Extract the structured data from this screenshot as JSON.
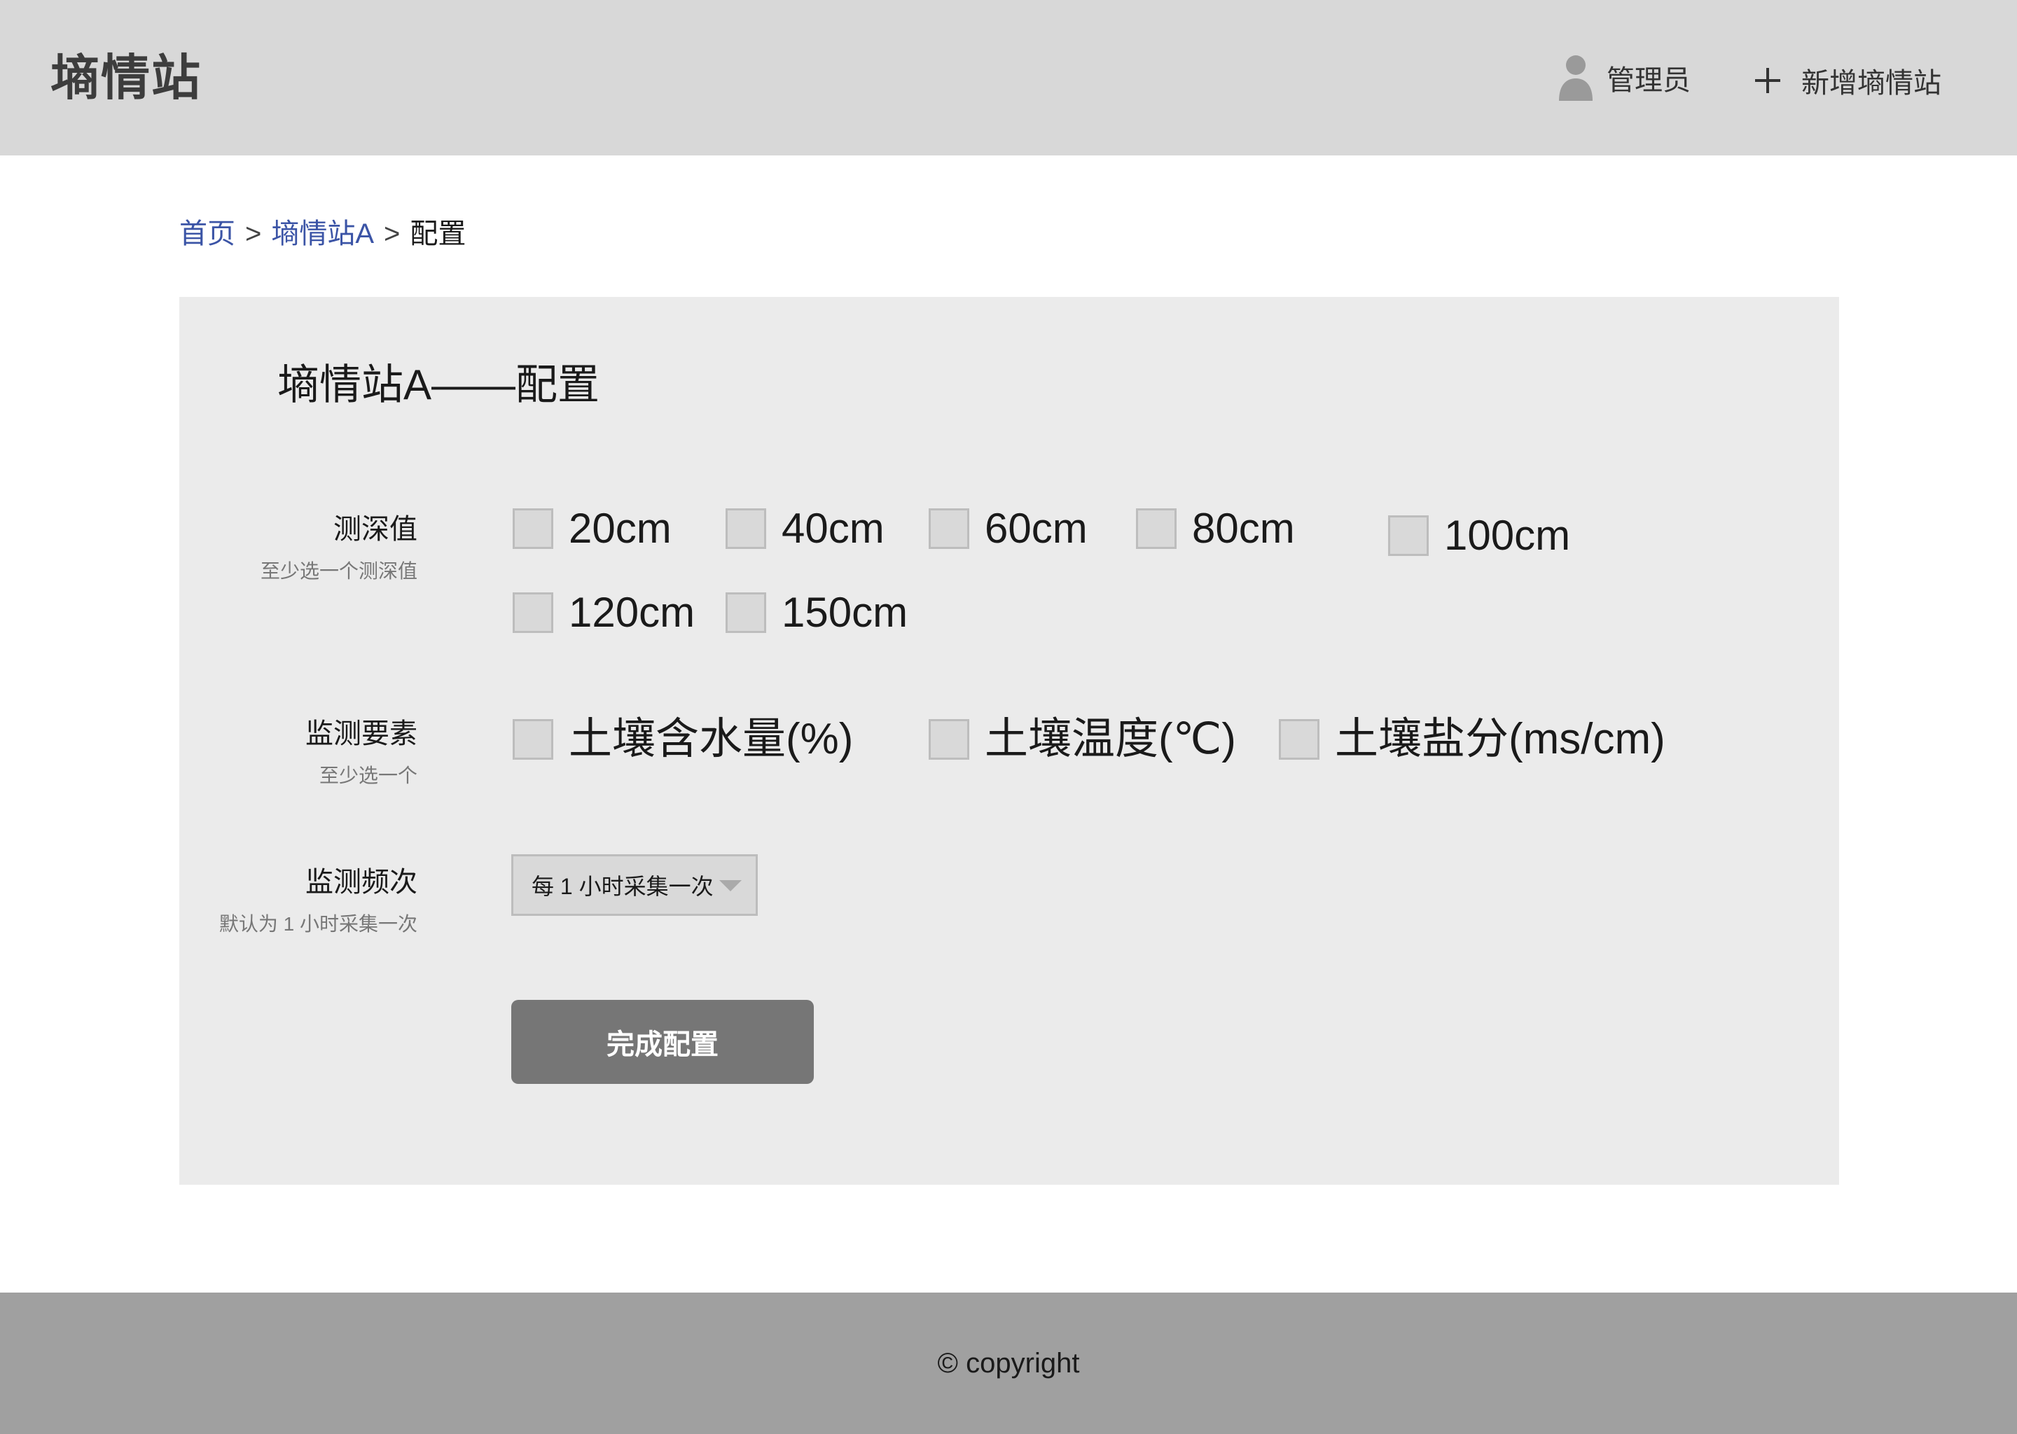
{
  "header": {
    "brand": "墒情站",
    "user_icon": "user-icon",
    "user_label": "管理员",
    "add_icon": "plus-icon",
    "add_label": "新增墒情站"
  },
  "breadcrumb": {
    "home": "首页",
    "separator": ">",
    "station": "墒情站A",
    "current": "配置"
  },
  "card": {
    "title": "墒情站A——配置",
    "depth": {
      "label": "测深值",
      "hint": "至少选一个测深值",
      "options": [
        {
          "label": "20cm",
          "checked": false
        },
        {
          "label": "40cm",
          "checked": false
        },
        {
          "label": "60cm",
          "checked": false
        },
        {
          "label": "80cm",
          "checked": false
        },
        {
          "label": "100cm",
          "checked": false
        },
        {
          "label": "120cm",
          "checked": false
        },
        {
          "label": "150cm",
          "checked": false
        }
      ]
    },
    "elements": {
      "label": "监测要素",
      "hint": "至少选一个",
      "options": [
        {
          "label": "土壤含水量(%)",
          "checked": false
        },
        {
          "label": "土壤温度(℃)",
          "checked": false
        },
        {
          "label": "土壤盐分(ms/cm)",
          "checked": false
        }
      ]
    },
    "frequency": {
      "label": "监测频次",
      "hint": "默认为 1 小时采集一次",
      "selected": "每 1 小时采集一次"
    },
    "submit_label": "完成配置"
  },
  "footer": {
    "text": "© copyright"
  },
  "colors": {
    "header_bg": "#d8d8d8",
    "card_bg": "#ebebeb",
    "link": "#3b54a6",
    "button_bg": "#767676",
    "footer_bg": "#a0a0a0"
  }
}
